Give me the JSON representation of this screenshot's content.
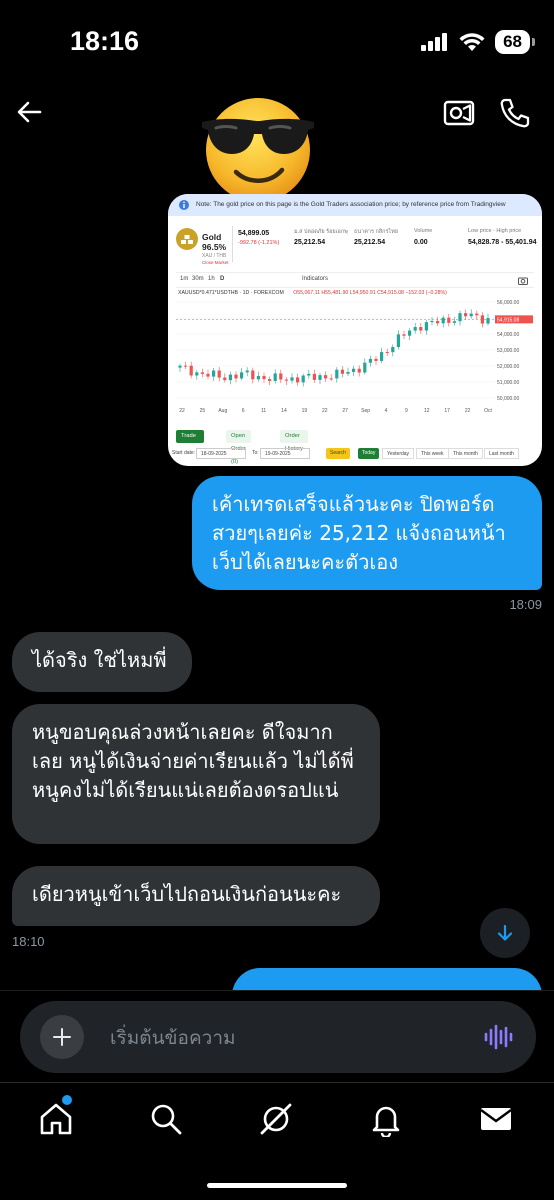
{
  "status_bar": {
    "time": "18:16",
    "battery": "68"
  },
  "messages": {
    "outgoing_1": "เค้าเทรดเสร็จแล้วนะคะ ปิดพอร์ดสวยๆเลยค่ะ 25,212 แจ้งถอนหน้าเว็บได้เลยนะคะตัวเอง",
    "outgoing_1_time": "18:09",
    "incoming_1": "ได้จริง ใช่ไหมพี่",
    "incoming_2": "หนูขอบคุณล่วงหน้าเลยคะ ดีใจมากเลย หนูได้เงินจ่ายค่าเรียนแล้ว ไม่ได้พี่หนูคงไม่ได้เรียนแน่เลยต้องดรอปแน่",
    "incoming_3": "เดียวหนูเข้าเว็บไปถอนเงินก่อนนะคะ",
    "incoming_3_time": "18:10"
  },
  "compose": {
    "placeholder": "เริ่มต้นข้อความ"
  },
  "screenshot": {
    "note": "Note: The gold price on this page is the Gold Traders association price; by reference price from Tradingview",
    "gold_name": "Gold",
    "gold_purity": "96.5%",
    "gold_pair": "XAU / THB",
    "closed": "Close Market",
    "price": "54,899.05",
    "change": "-992.78 (-1.21%)",
    "buy_label": "ม.ส ปลอดภัย ร้อยเอกพุ",
    "buy_value": "25,212.54",
    "sell_label": "ธนาคาร กสิกรไทย",
    "sell_value": "25,212.54",
    "volume_label": "Volume",
    "volume_value": "0.00",
    "range_label": "Low price - High price",
    "range_value": "54,828.78 - 55,401.94",
    "toolbar_items": [
      "1m",
      "30m",
      "1h",
      "D",
      "Indicators"
    ],
    "legend_symbol": "XAUUSD*0.471*USDTHB · 1D · FOREXCOM",
    "legend_values": "O55,067.11 H55,481.90 L54,950.91 C54,915.08 −152.03 (−0.28%)",
    "x_labels": [
      "22",
      "25",
      "Aug",
      "6",
      "11",
      "14",
      "19",
      "22",
      "27",
      "Sep",
      "4",
      "9",
      "12",
      "17",
      "22",
      "Oct"
    ],
    "y_labels": [
      "56,000.00",
      "55,000.00",
      "54,000.00",
      "53,000.00",
      "52,000.00",
      "51,000.00",
      "50,000.00"
    ],
    "last_price_tag": "54,915.08",
    "tabs": [
      "Trade History",
      "Open Order (0)",
      "Order History"
    ],
    "start_date_label": "Start date:",
    "start_date": "18-09-2025",
    "to_label": "To:",
    "to_date": "19-09-2025",
    "search": "Search",
    "quick_filters": [
      "Today",
      "Yesterday",
      "This week",
      "This month",
      "Last month"
    ],
    "colors": {
      "up": "#26a69a",
      "down": "#ef5350",
      "tab_active": "#1e7e34",
      "search_btn": "#f5c518"
    }
  },
  "chart_data": {
    "type": "candlestick",
    "x": [
      "22",
      "25",
      "Aug",
      "6",
      "11",
      "14",
      "19",
      "22",
      "27",
      "Sep",
      "4",
      "9",
      "12",
      "17",
      "22",
      "Oct"
    ],
    "close_trend": [
      51900,
      51500,
      51300,
      51500,
      51200,
      51200,
      51300,
      51400,
      51800,
      52500,
      53800,
      54600,
      54800,
      55200,
      54915
    ],
    "ylim": [
      50000,
      56000
    ]
  },
  "colors": {
    "accent": "#1d9bf0",
    "incoming_bubble": "#2f3336"
  }
}
